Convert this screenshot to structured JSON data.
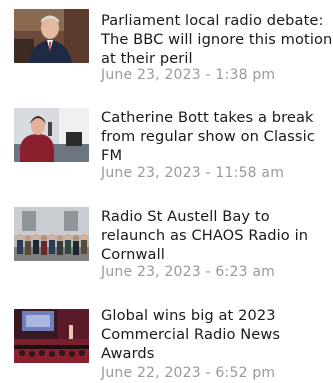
{
  "news": {
    "items": [
      {
        "headline": "Parliament local radio debate: The BBC will ignore this motion at their peril",
        "date": "June 23, 2023 - 1:38 pm",
        "thumbnail": "man-in-suit-parliament-photo"
      },
      {
        "headline": "Catherine Bott takes a break from regular show on Classic FM",
        "date": "June 23, 2023 - 11:58 am",
        "thumbnail": "presenter-in-studio-photo"
      },
      {
        "headline": "Radio St Austell Bay to relaunch as CHAOS Radio in Cornwall",
        "date": "June 23, 2023 - 6:23 am",
        "thumbnail": "group-outside-building-photo"
      },
      {
        "headline": "Global wins big at 2023 Commercial Radio News Awards",
        "date": "June 22, 2023 - 6:52 pm",
        "thumbnail": "awards-stage-photo"
      }
    ]
  }
}
